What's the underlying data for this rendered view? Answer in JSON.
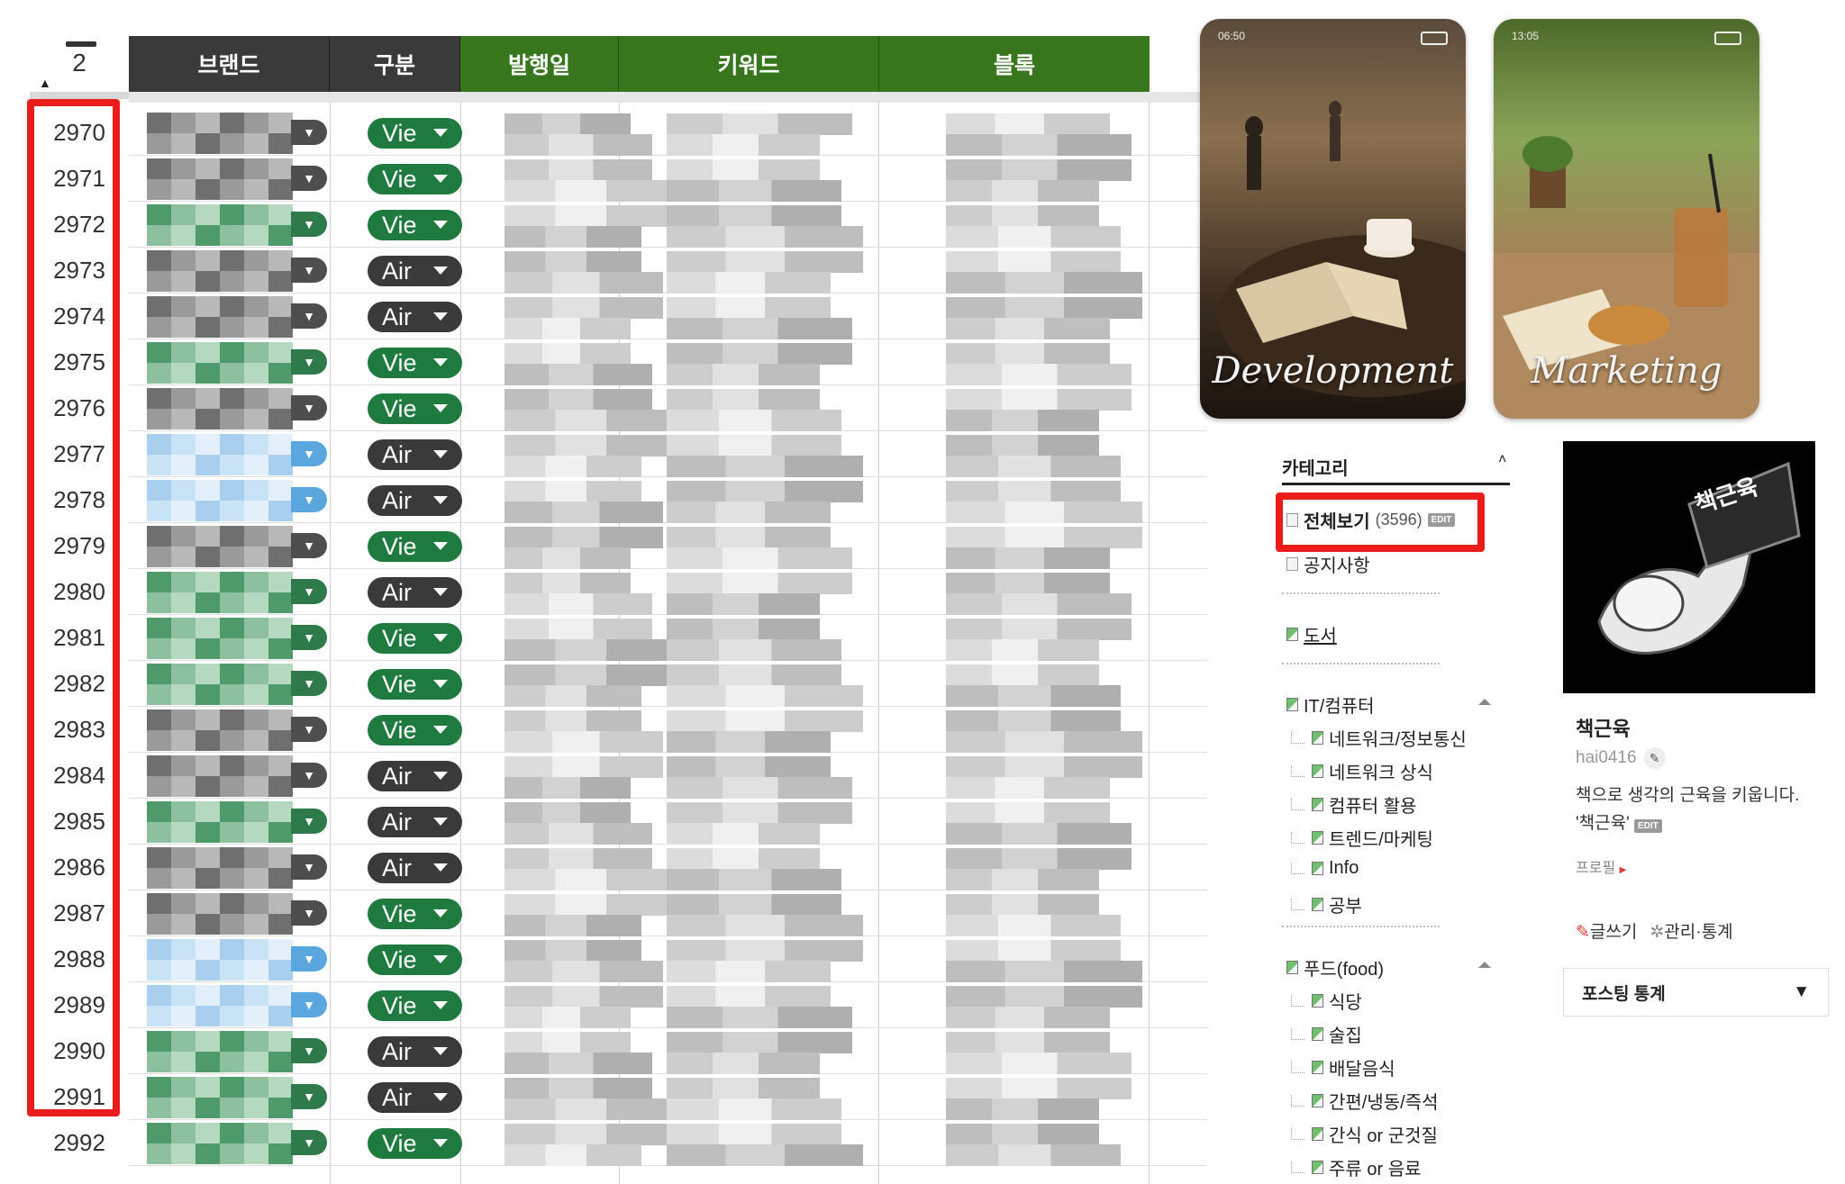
{
  "sheet": {
    "freeze_count": "2",
    "headers": [
      "브랜드",
      "구분",
      "발행일",
      "키워드",
      "블록"
    ],
    "rows": [
      {
        "num": "2970",
        "type": "Vie",
        "brand": "gray"
      },
      {
        "num": "2971",
        "type": "Vie",
        "brand": "gray"
      },
      {
        "num": "2972",
        "type": "Vie",
        "brand": "green"
      },
      {
        "num": "2973",
        "type": "Air",
        "brand": "gray"
      },
      {
        "num": "2974",
        "type": "Air",
        "brand": "gray"
      },
      {
        "num": "2975",
        "type": "Vie",
        "brand": "green"
      },
      {
        "num": "2976",
        "type": "Vie",
        "brand": "gray"
      },
      {
        "num": "2977",
        "type": "Air",
        "brand": "blue"
      },
      {
        "num": "2978",
        "type": "Air",
        "brand": "blue"
      },
      {
        "num": "2979",
        "type": "Vie",
        "brand": "gray"
      },
      {
        "num": "2980",
        "type": "Air",
        "brand": "green"
      },
      {
        "num": "2981",
        "type": "Vie",
        "brand": "green"
      },
      {
        "num": "2982",
        "type": "Vie",
        "brand": "green"
      },
      {
        "num": "2983",
        "type": "Vie",
        "brand": "gray"
      },
      {
        "num": "2984",
        "type": "Air",
        "brand": "gray"
      },
      {
        "num": "2985",
        "type": "Air",
        "brand": "green"
      },
      {
        "num": "2986",
        "type": "Air",
        "brand": "gray"
      },
      {
        "num": "2987",
        "type": "Vie",
        "brand": "gray"
      },
      {
        "num": "2988",
        "type": "Vie",
        "brand": "blue"
      },
      {
        "num": "2989",
        "type": "Vie",
        "brand": "blue"
      },
      {
        "num": "2990",
        "type": "Air",
        "brand": "green"
      },
      {
        "num": "2991",
        "type": "Air",
        "brand": "green"
      },
      {
        "num": "2992",
        "type": "Vie",
        "brand": "green"
      }
    ]
  },
  "blog": {
    "covers": [
      {
        "label": "Development",
        "time": "06:50"
      },
      {
        "label": "Marketing",
        "time": "13:05"
      }
    ],
    "category": {
      "title": "카테고리",
      "toggle": "˄",
      "all_label": "전체보기",
      "all_count": "(3596)",
      "edit": "EDIT",
      "notice": "공지사항",
      "books": "도서",
      "it": "IT/컴퓨터",
      "it_children": [
        "네트워크/정보통신",
        "네트워크 상식",
        "컴퓨터 활용",
        "트렌드/마케팅",
        "Info",
        "공부"
      ],
      "food": "푸드(food)",
      "food_children": [
        "식당",
        "술집",
        "배달음식",
        "간편/냉동/즉석",
        "간식 or 군것질",
        "주류 or 음료"
      ]
    },
    "profile": {
      "avatar_text": "책근육",
      "name": "책근육",
      "id": "hai0416",
      "desc": "책으로 생각의 근육을 키웁니다. '책근육'",
      "edit": "EDIT",
      "profile_link": "프로필",
      "write": "글쓰기",
      "manage": "관리·통계",
      "stats": "포스팅 통계",
      "stats_arrow": "▼"
    }
  },
  "colors": {
    "header_dark": "#3a3a3a",
    "header_green": "#38761d",
    "vie_pill": "#1f7a3f",
    "air_pill": "#3a3a3a",
    "highlight": "#ea1c1c"
  }
}
